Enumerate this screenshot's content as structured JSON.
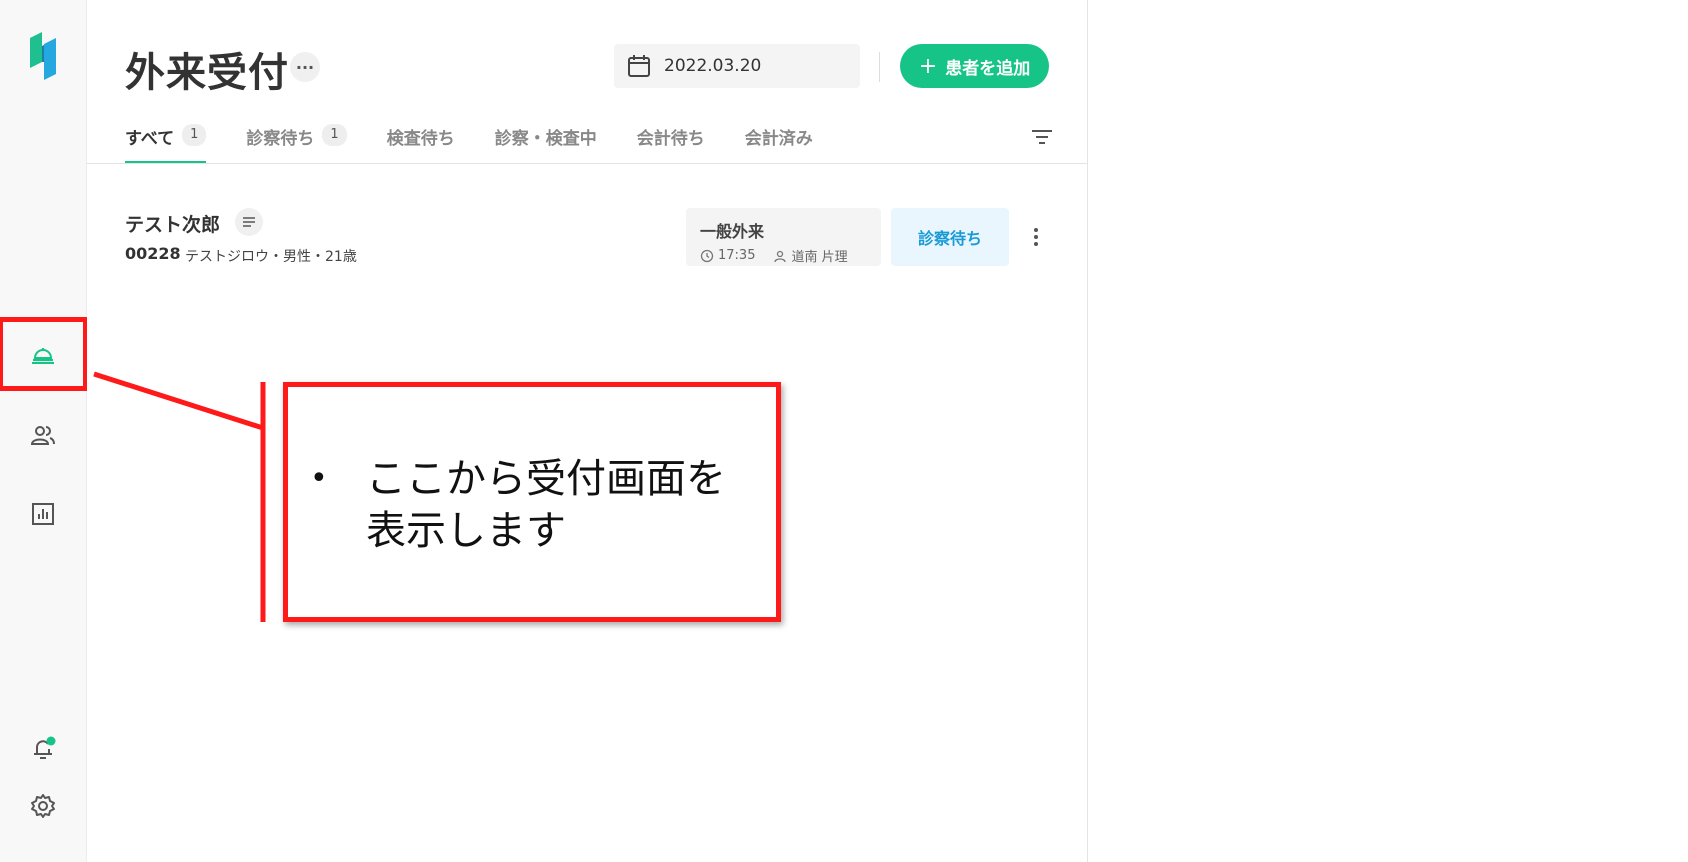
{
  "sidebar": {
    "items": [
      {
        "name": "reception-icon",
        "active": true
      },
      {
        "name": "patients-icon",
        "active": false
      },
      {
        "name": "reports-icon",
        "active": false
      }
    ],
    "bottom": [
      {
        "name": "bell-icon",
        "badge": true
      },
      {
        "name": "gear-icon"
      }
    ]
  },
  "header": {
    "title": "外来受付",
    "more_label": "···",
    "date": "2022.03.20",
    "add_button": "患者を追加"
  },
  "tabs": [
    {
      "label": "すべて",
      "count": "1",
      "active": true
    },
    {
      "label": "診察待ち",
      "count": "1",
      "active": false
    },
    {
      "label": "検査待ち",
      "count": "",
      "active": false
    },
    {
      "label": "診察・検査中",
      "count": "",
      "active": false
    },
    {
      "label": "会計待ち",
      "count": "",
      "active": false
    },
    {
      "label": "会計済み",
      "count": "",
      "active": false
    }
  ],
  "patient": {
    "name": "テスト次郎",
    "id": "00228",
    "detail": "テストジロウ・男性・21歳",
    "visit_type": "一般外来",
    "time": "17:35",
    "doctor": "道南 片理",
    "status": "診察待ち"
  },
  "callout": {
    "bullet": "•",
    "text_line1": "ここから受付画面を",
    "text_line2": "表示します"
  },
  "colors": {
    "accent": "#17c487",
    "status_blue": "#1a9bd7",
    "annotation_red": "#ff1a1a"
  }
}
